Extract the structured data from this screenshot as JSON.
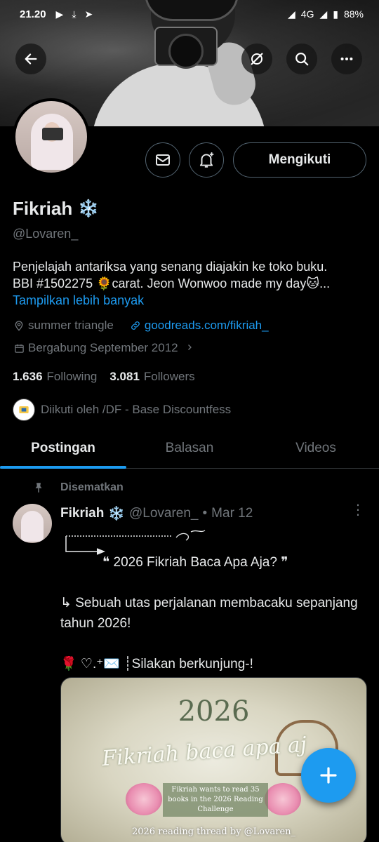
{
  "status_bar": {
    "time": "21.20",
    "network": "4G",
    "battery": "88%"
  },
  "profile": {
    "name": "Fikriah",
    "name_emoji": "❄️",
    "handle": "@Lovaren_",
    "bio_line1": "Penjelajah antariksa yang senang diajakin ke toko buku.",
    "bio_line2": "BBI #1502275 🌻carat. Jeon Wonwoo made my day🐱...",
    "show_more": "Tampilkan lebih banyak",
    "location": "summer triangle",
    "website": "goodreads.com/fikriah_",
    "joined": "Bergabung September 2012",
    "following_count": "1.636",
    "following_label": "Following",
    "followers_count": "3.081",
    "followers_label": "Followers",
    "followed_by": "Diikuti oleh /DF - Base Discountfess"
  },
  "actions": {
    "follow_label": "Mengikuti"
  },
  "tabs": [
    {
      "label": "Postingan"
    },
    {
      "label": "Balasan"
    },
    {
      "label": "Videos"
    }
  ],
  "post": {
    "pinned_label": "Disematkan",
    "author": "Fikriah",
    "author_emoji": "❄️",
    "handle": "@Lovaren_",
    "dot": "•",
    "date": "Mar 12",
    "line_title": "❝ 2026 Fikriah Baca Apa Aja? ❞",
    "line_thread": "↳ Sebuah utas perjalanan membacaku sepanjang tahun 2026!",
    "line_visit": "🌹 ♡.⁺✉️ ┊Silakan berkunjung-!",
    "media": {
      "year": "2026",
      "script_title": "Fikriah baca apa aj",
      "challenge": "Fikriah wants to read 35 books in the 2026 Reading Challenge",
      "thread_caption": "2026 reading thread by @Lovaren_"
    }
  },
  "fab": {
    "icon": "plus-icon"
  },
  "colors": {
    "accent": "#1d9bf0",
    "text_primary": "#e7e9ea",
    "text_secondary": "#71767b",
    "border": "#2f3336",
    "background": "#000000"
  }
}
